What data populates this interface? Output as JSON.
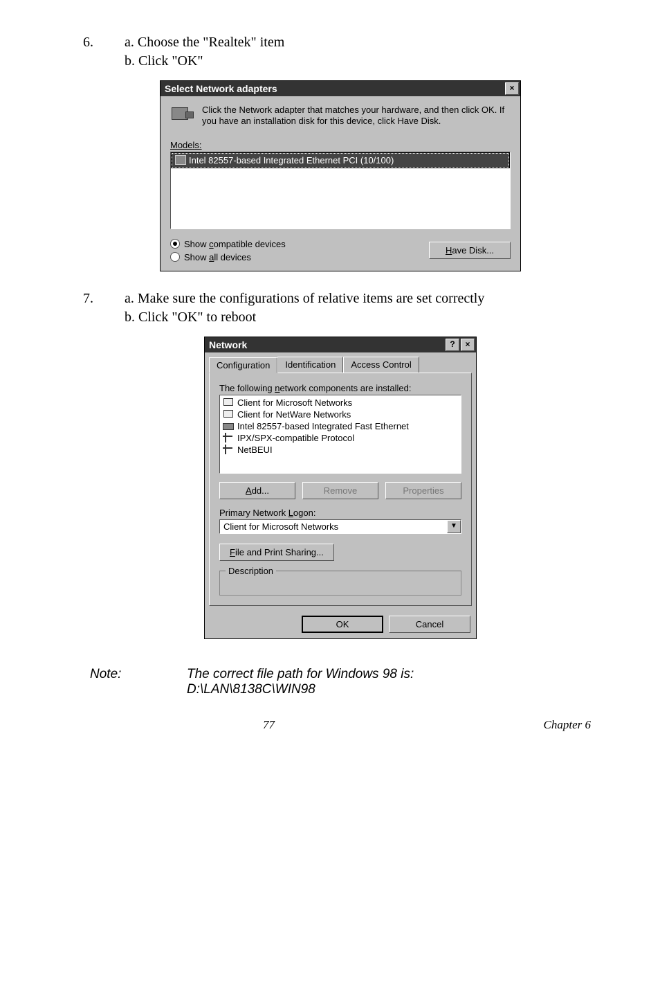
{
  "step6": {
    "num": "6.",
    "a": "a. Choose the \"Realtek\" item",
    "b": "b. Click \"OK\""
  },
  "dlg1": {
    "title": "Select Network adapters",
    "info": "Click the Network adapter that matches your hardware, and then click OK. If you have an installation disk for this device, click Have Disk.",
    "models_label": "Models:",
    "item": "Intel 82557-based Integrated Ethernet PCI (10/100)",
    "radio_compatible": "Show compatible devices",
    "radio_all": "Show all devices",
    "have_disk": "Have Disk..."
  },
  "step7": {
    "num": "7.",
    "a": "a. Make sure the configurations of relative items are set correctly",
    "b": "b. Click \"OK\" to reboot"
  },
  "dlg2": {
    "title": "Network",
    "tabs": {
      "configuration": "Configuration",
      "identification": "Identification",
      "access": "Access Control"
    },
    "list_label": "The following network components are installed:",
    "items": [
      "Client for Microsoft Networks",
      "Client for NetWare Networks",
      "Intel 82557-based Integrated Fast Ethernet",
      "IPX/SPX-compatible Protocol",
      "NetBEUI"
    ],
    "add": "Add...",
    "remove": "Remove",
    "properties": "Properties",
    "logon_label": "Primary Network Logon:",
    "logon_value": "Client for Microsoft Networks",
    "file_sharing": "File and Print Sharing...",
    "description": "Description",
    "ok": "OK",
    "cancel": "Cancel"
  },
  "note": {
    "label": "Note:",
    "line1": "The correct file path for Windows 98 is:",
    "line2": "D:\\LAN\\8138C\\WIN98"
  },
  "footer": {
    "page": "77",
    "chapter": "Chapter 6"
  }
}
